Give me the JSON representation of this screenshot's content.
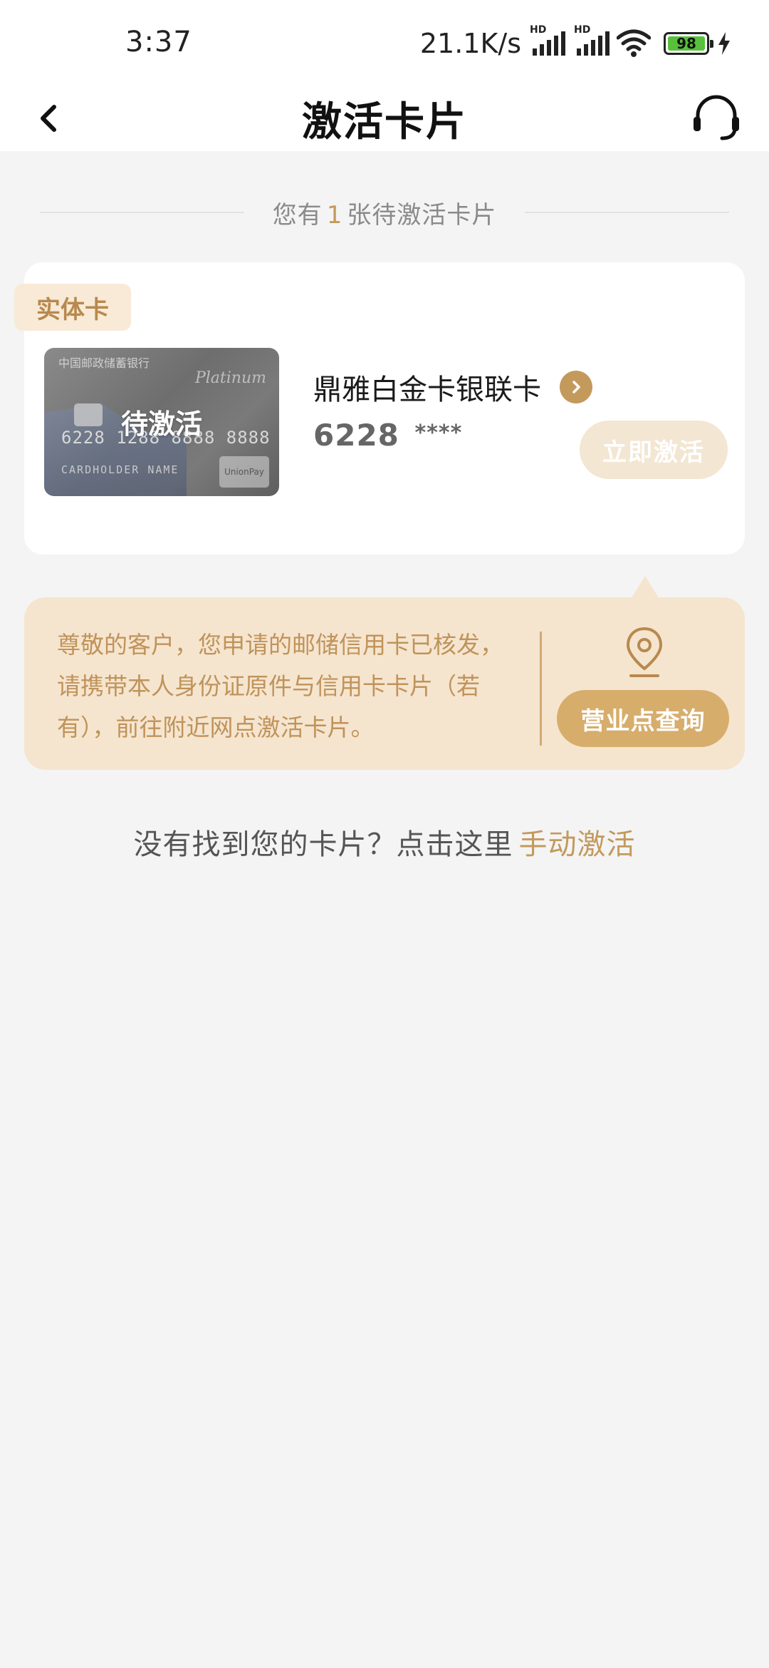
{
  "status_bar": {
    "time": "3:37",
    "net_speed": "21.1K/s",
    "signal_label": "HD",
    "battery_level": "98",
    "battery_color": "#58c13b"
  },
  "nav": {
    "title": "激活卡片",
    "back_icon": "chevron-left-icon",
    "service_icon": "headset-icon"
  },
  "pending": {
    "prefix": "您有",
    "count": "1",
    "suffix": "张待激活卡片"
  },
  "card_section": {
    "tag": "实体卡",
    "card": {
      "image_bank_name": "中国邮政储蓄银行",
      "image_tier": "Platinum",
      "image_number": "6228 1288 8888 8888",
      "image_holder": "CARDHOLDER NAME",
      "image_network": "UnionPay",
      "status_overlay": "待激活",
      "name": "鼎雅白金卡银联卡",
      "number_prefix": "6228",
      "number_mask": "****",
      "activate_label": "立即激活"
    }
  },
  "notice": {
    "text": "尊敬的客户，您申请的邮储信用卡已核发，请携带本人身份证原件与信用卡卡片（若有），前往附近网点激活卡片。",
    "branch_button": "营业点查询",
    "accent_color": "#c39a5c"
  },
  "manual": {
    "prompt": "没有找到您的卡片？点击这里",
    "link": "手动激活"
  }
}
